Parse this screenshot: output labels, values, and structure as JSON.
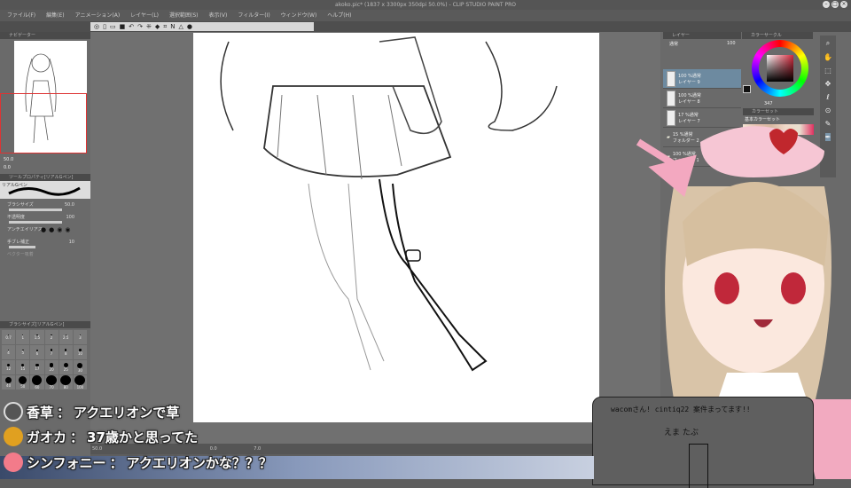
{
  "window": {
    "title": "akoko.pic* (1837 x 3300px 350dpi 50.0%) - CLIP STUDIO PAINT PRO"
  },
  "menu": [
    "ファイル(F)",
    "編集(E)",
    "アニメーション(A)",
    "レイヤー(L)",
    "選択範囲(S)",
    "表示(V)",
    "フィルター(I)",
    "ウィンドウ(W)",
    "ヘルプ(H)"
  ],
  "left": {
    "navigator_tab": "ナビゲーター",
    "zoom_value": "50.0",
    "rotate_value": "0.0",
    "tool_property_tab": "ツールプロパティ[リアルGペン]",
    "brush_name": "リアルGペン",
    "props": [
      {
        "label": "ブラシサイズ",
        "value": "50.0"
      },
      {
        "label": "不透明度",
        "value": "100"
      },
      {
        "label": "アンチエイリアス",
        "value": ""
      },
      {
        "label": "手ブレ補正",
        "value": "10"
      },
      {
        "label": "ベクター吸着",
        "value": ""
      }
    ],
    "brush_size_tab": "ブラシサイズ[リアルGペン]",
    "brush_sizes": [
      "0.7",
      "1",
      "1.5",
      "2",
      "2.5",
      "3",
      "4",
      "5",
      "6",
      "7",
      "8",
      "10",
      "12",
      "15",
      "17",
      "20",
      "25",
      "30",
      "40",
      "50",
      "60",
      "70",
      "80",
      "100"
    ]
  },
  "status": {
    "zoom": "50.0",
    "angle": "0.0",
    "coords": "7.0"
  },
  "right": {
    "layer_tab": "レイヤー",
    "blend_mode": "通常",
    "opacity": "100",
    "layers": [
      {
        "opacity": "100 %通常",
        "name": "レイヤー 9"
      },
      {
        "opacity": "100 %通常",
        "name": "レイヤー 8"
      },
      {
        "opacity": "17 %通常",
        "name": "レイヤー 7"
      },
      {
        "opacity": "15 %通常",
        "name": "フォルダー 2"
      },
      {
        "opacity": "100 %通常",
        "name": "フォルダー 1"
      }
    ],
    "color_wheel_tab": "カラーサークル",
    "color_value": "347",
    "color_set_tab": "カラーセット",
    "color_set_name": "基本カラーセット",
    "accent": "#d4283c"
  },
  "chat": [
    {
      "user": "香草",
      "message": "アクエリオンで草"
    },
    {
      "user": "ガオカ",
      "message": "37歳かと思ってた"
    },
    {
      "user": "シンフォニー",
      "message": "アクエリオンかな？？？"
    }
  ],
  "board": {
    "note": "wacomさん! cintiq22 案件まってます!!",
    "name": "えま たぶ"
  }
}
